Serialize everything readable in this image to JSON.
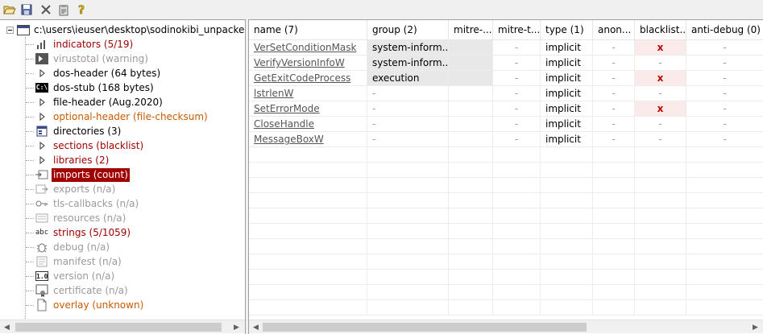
{
  "toolbar": {
    "buttons": [
      {
        "name": "open-folder-icon"
      },
      {
        "name": "save-icon"
      },
      {
        "name": "close-x-icon"
      },
      {
        "name": "clipboard-icon"
      },
      {
        "name": "help-icon"
      }
    ]
  },
  "tree": {
    "root_label": "c:\\users\\ieuser\\desktop\\sodinokibi_unpacked.bin",
    "items": [
      {
        "label": "indicators (5/19)",
        "color": "red",
        "icon": "bar-chart-icon"
      },
      {
        "label": "virustotal (warning)",
        "color": "gray",
        "icon": "virustotal-icon"
      },
      {
        "label": "dos-header (64 bytes)",
        "color": "black",
        "icon": "arrow-icon"
      },
      {
        "label": "dos-stub (168 bytes)",
        "color": "black",
        "icon": "console-icon"
      },
      {
        "label": "file-header (Aug.2020)",
        "color": "black",
        "icon": "arrow-icon"
      },
      {
        "label": "optional-header (file-checksum)",
        "color": "orange",
        "icon": "arrow-icon"
      },
      {
        "label": "directories (3)",
        "color": "black",
        "icon": "directories-icon"
      },
      {
        "label": "sections (blacklist)",
        "color": "red",
        "icon": "arrow-icon"
      },
      {
        "label": "libraries (2)",
        "color": "red",
        "icon": "arrow-icon"
      },
      {
        "label": "imports (count)",
        "color": "red",
        "icon": "imports-icon",
        "selected": true
      },
      {
        "label": "exports (n/a)",
        "color": "gray",
        "icon": "exports-icon"
      },
      {
        "label": "tls-callbacks (n/a)",
        "color": "gray",
        "icon": "key-icon"
      },
      {
        "label": "resources (n/a)",
        "color": "gray",
        "icon": "resources-icon"
      },
      {
        "label": "strings (5/1059)",
        "color": "red",
        "icon": "strings-icon"
      },
      {
        "label": "debug (n/a)",
        "color": "gray",
        "icon": "bug-icon"
      },
      {
        "label": "manifest (n/a)",
        "color": "gray",
        "icon": "manifest-icon"
      },
      {
        "label": "version (n/a)",
        "color": "gray",
        "icon": "version-icon"
      },
      {
        "label": "certificate (n/a)",
        "color": "gray",
        "icon": "certificate-icon"
      },
      {
        "label": "overlay (unknown)",
        "color": "orange",
        "icon": "document-icon"
      }
    ],
    "strings_icon_text": "abc",
    "console_icon_text": "C:\\",
    "version_icon_text": "1.0"
  },
  "table": {
    "columns": [
      {
        "label": "name (7)"
      },
      {
        "label": "group (2)"
      },
      {
        "label": "mitre-..."
      },
      {
        "label": "mitre-t..."
      },
      {
        "label": "type (1)"
      },
      {
        "label": "anon..."
      },
      {
        "label": "blacklist..."
      },
      {
        "label": "anti-debug (0)"
      }
    ],
    "rows": [
      {
        "name": "VerSetConditionMask",
        "group": "system-inform...",
        "mitre_a": "",
        "mitre_t": "-",
        "type": "implicit",
        "anon": "-",
        "blacklist": "x",
        "anti_debug": "-"
      },
      {
        "name": "VerifyVersionInfoW",
        "group": "system-inform...",
        "mitre_a": "",
        "mitre_t": "-",
        "type": "implicit",
        "anon": "-",
        "blacklist": "-",
        "anti_debug": "-"
      },
      {
        "name": "GetExitCodeProcess",
        "group": "execution",
        "mitre_a": "",
        "mitre_t": "-",
        "type": "implicit",
        "anon": "-",
        "blacklist": "x",
        "anti_debug": "-"
      },
      {
        "name": "lstrlenW",
        "group": "-",
        "mitre_a": "",
        "mitre_t": "-",
        "type": "implicit",
        "anon": "-",
        "blacklist": "-",
        "anti_debug": "-"
      },
      {
        "name": "SetErrorMode",
        "group": "-",
        "mitre_a": "",
        "mitre_t": "-",
        "type": "implicit",
        "anon": "-",
        "blacklist": "x",
        "anti_debug": "-"
      },
      {
        "name": "CloseHandle",
        "group": "-",
        "mitre_a": "",
        "mitre_t": "-",
        "type": "implicit",
        "anon": "-",
        "blacklist": "-",
        "anti_debug": "-"
      },
      {
        "name": "MessageBoxW",
        "group": "-",
        "mitre_a": "",
        "mitre_t": "-",
        "type": "implicit",
        "anon": "-",
        "blacklist": "-",
        "anti_debug": "-"
      }
    ]
  },
  "scrollbars": {
    "left_arrow": "◀",
    "right_arrow": "▶"
  }
}
